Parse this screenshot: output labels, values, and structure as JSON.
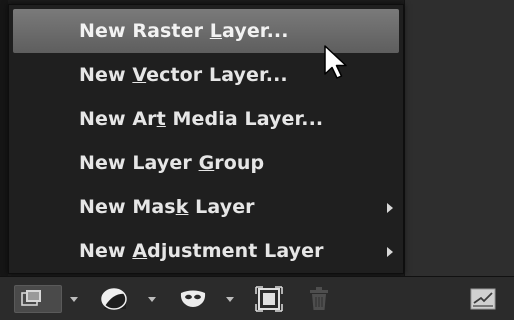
{
  "menu": {
    "items": [
      {
        "pre": "New Raster ",
        "ul": "L",
        "post": "ayer...",
        "submenu": false,
        "highlighted": true
      },
      {
        "pre": "New ",
        "ul": "V",
        "post": "ector Layer...",
        "submenu": false,
        "highlighted": false
      },
      {
        "pre": "New Ar",
        "ul": "t",
        "post": " Media Layer...",
        "submenu": false,
        "highlighted": false
      },
      {
        "pre": "New Layer ",
        "ul": "G",
        "post": "roup",
        "submenu": false,
        "highlighted": false
      },
      {
        "pre": "New Mas",
        "ul": "k",
        "post": " Layer",
        "submenu": true,
        "highlighted": false
      },
      {
        "pre": "New ",
        "ul": "A",
        "post": "djustment Layer",
        "submenu": true,
        "highlighted": false
      }
    ]
  },
  "toolbar": {
    "icons": [
      "new-layer-icon",
      "adjustment-icon",
      "mask-icon",
      "reference-icon",
      "trash-icon",
      "layer-properties-icon"
    ]
  },
  "colors": {
    "menu_bg": "#1f1f1f",
    "highlight": "#6a6a6a",
    "toolbar_bg": "#2b2b2b",
    "text": "#e6e6e6"
  }
}
